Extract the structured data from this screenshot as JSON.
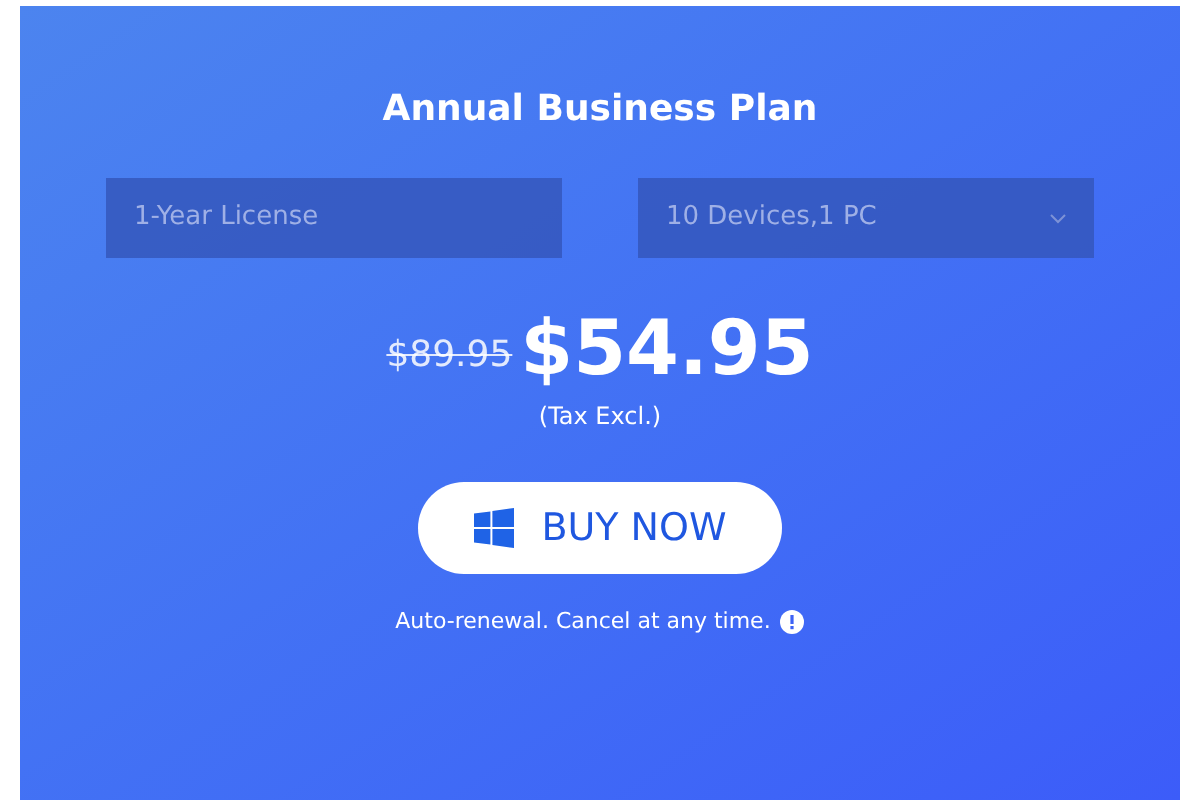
{
  "plan": {
    "title": "Annual Business Plan",
    "license": {
      "value": "1-Year License"
    },
    "devices": {
      "value": "10 Devices,1 PC"
    },
    "old_price": "$89.95",
    "price": "$54.95",
    "tax_note": "(Tax Excl.)",
    "buy_button": "BUY NOW",
    "renewal_note": "Auto-renewal. Cancel at any time."
  }
}
